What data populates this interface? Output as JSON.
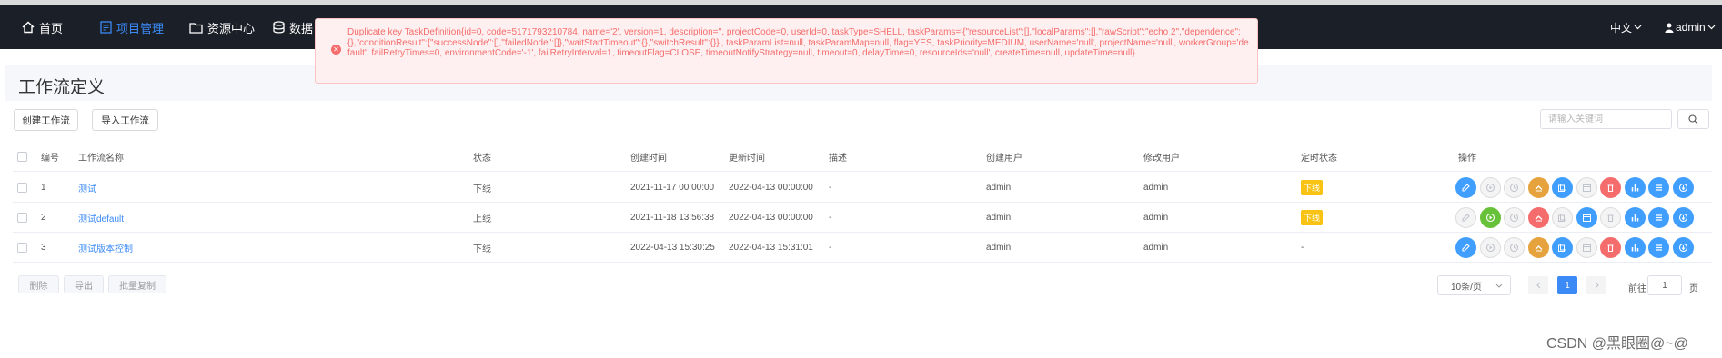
{
  "nav": {
    "home": "首页",
    "project": "项目管理",
    "resource": "资源中心",
    "data": "数据",
    "lang": "中文",
    "user": "admin"
  },
  "page": {
    "title": "工作流定义",
    "create_btn": "创建工作流",
    "import_btn": "导入工作流",
    "search_placeholder": "请输入关键词"
  },
  "table": {
    "headers": [
      "编号",
      "工作流名称",
      "状态",
      "创建时间",
      "更新时间",
      "描述",
      "创建用户",
      "修改用户",
      "定时状态",
      "操作"
    ],
    "rows": [
      {
        "id": "1",
        "name": "测试",
        "status": "下线",
        "created": "2021-11-17 00:00:00",
        "updated": "2022-04-13 00:00:00",
        "desc": "-",
        "creator": "admin",
        "modifier": "admin",
        "schedule": "下线",
        "schedule_tag": true,
        "ops": [
          "#409eff",
          "grey",
          "grey",
          "#e6a23c",
          "#409eff",
          "grey",
          "#f56c6c",
          "#409eff",
          "#409eff",
          "#409eff"
        ]
      },
      {
        "id": "2",
        "name": "测试default",
        "status": "上线",
        "created": "2021-11-18 13:56:38",
        "updated": "2022-04-13 00:00:00",
        "desc": "-",
        "creator": "admin",
        "modifier": "admin",
        "schedule": "下线",
        "schedule_tag": true,
        "ops": [
          "grey",
          "#67c23a",
          "grey",
          "#f56c6c",
          "grey",
          "#409eff",
          "grey",
          "#409eff",
          "#409eff",
          "#409eff"
        ]
      },
      {
        "id": "3",
        "name": "测试版本控制",
        "status": "下线",
        "created": "2022-04-13 15:30:25",
        "updated": "2022-04-13 15:31:01",
        "desc": "-",
        "creator": "admin",
        "modifier": "admin",
        "schedule": "-",
        "schedule_tag": false,
        "ops": [
          "#409eff",
          "grey",
          "grey",
          "#e6a23c",
          "#409eff",
          "grey",
          "#f56c6c",
          "#409eff",
          "#409eff",
          "#409eff"
        ]
      }
    ]
  },
  "footer": {
    "delete_btn": "删除",
    "export_btn": "导出",
    "batch_copy_btn": "批量复制",
    "page_size": "10条/页",
    "current_page": "1",
    "goto_label": "前往",
    "goto_value": "1",
    "page_suffix": "页"
  },
  "error": {
    "message": "Duplicate key TaskDefinition{id=0, code=5171793210784, name='2', version=1, description='', projectCode=0, userId=0, taskType=SHELL, taskParams='{\"resourceList\":[],\"localParams\":[],\"rawScript\":\"echo 2\",\"dependence\":{},\"conditionResult\":{\"successNode\":[],\"failedNode\":[]},\"waitStartTimeout\":{},\"switchResult\":{}}', taskParamList=null, taskParamMap=null, flag=YES, taskPriority=MEDIUM, userName='null', projectName='null', workerGroup='default', failRetryTimes=0, environmentCode='-1', failRetryInterval=1, timeoutFlag=CLOSE, timeoutNotifyStrategy=null, timeout=0, delayTime=0, resourceIds='null', createTime=null, updateTime=null}"
  },
  "watermark": "CSDN @黑眼圈@~@",
  "colors": {
    "nav_bg": "#1b1f27",
    "accent": "#3b8af6",
    "error": "#f56c6c",
    "tag": "#f8c315"
  }
}
